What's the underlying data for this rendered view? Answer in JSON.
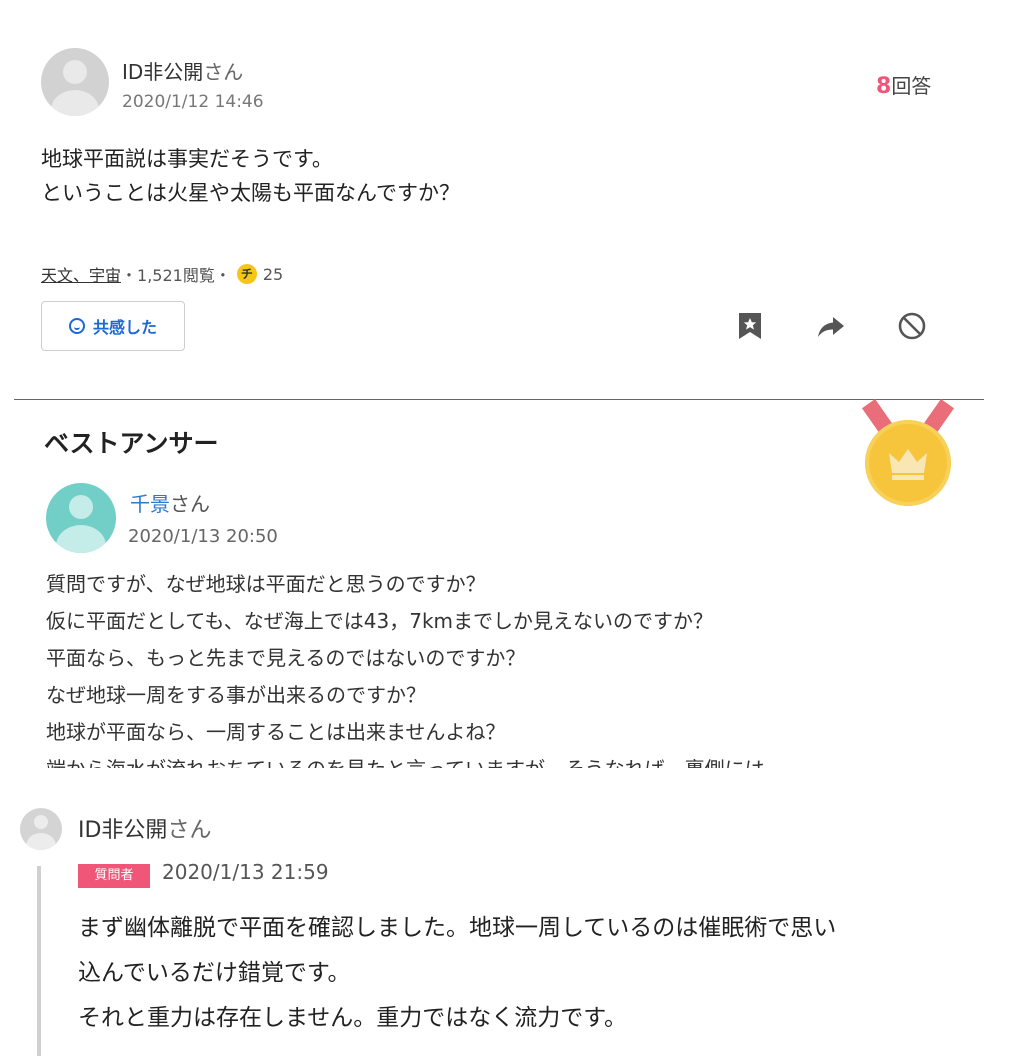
{
  "question": {
    "user": "ID非公開",
    "user_suffix": "さん",
    "date": "2020/1/12 14:46",
    "answers_count": "8",
    "answers_label": "回答",
    "text": "地球平面説は事実だそうです。\nということは火星や太陽も平面なんですか？",
    "category": "天文、宇宙",
    "views": "・1,521閲覧・",
    "coin_symbol": "チ",
    "coins": "25",
    "empathy_label": "共感した"
  },
  "best_answer": {
    "title": "ベストアンサー",
    "user": "千景",
    "user_suffix": "さん",
    "date": "2020/1/13 20:50",
    "text": "質問ですが、なぜ地球は平面だと思うのですか？\n仮に平面だとしても、なぜ海上では43，7kmまでしか見えないのですか？\n平面なら、もっと先まで見えるのではないのですか？\nなぜ地球一周をする事が出来るのですか？\n地球が平面なら、一周することは出来ませんよね？\n端から海水が流れおちているのを見たと言っていますが、そうなれば、裏側には"
  },
  "reply": {
    "user": "ID非公開",
    "user_suffix": "さん",
    "badge": "質問者",
    "date": "2020/1/13 21:59",
    "text": "まず幽体離脱で平面を確認しました。地球一周しているのは催眠術で思い\n込んでいるだけ錯覚です。\nそれと重力は存在しません。重力ではなく流力です。"
  },
  "icons": {
    "bookmark": "bookmark-icon",
    "share": "share-arrow-icon",
    "block": "block-icon",
    "medal": "crown-medal-icon",
    "smile": "smile-icon"
  },
  "colors": {
    "accent_pink": "#f05678",
    "link_blue": "#1d67d8",
    "medal_gold": "#f6c53c",
    "avatar_teal": "#72cfc7"
  }
}
